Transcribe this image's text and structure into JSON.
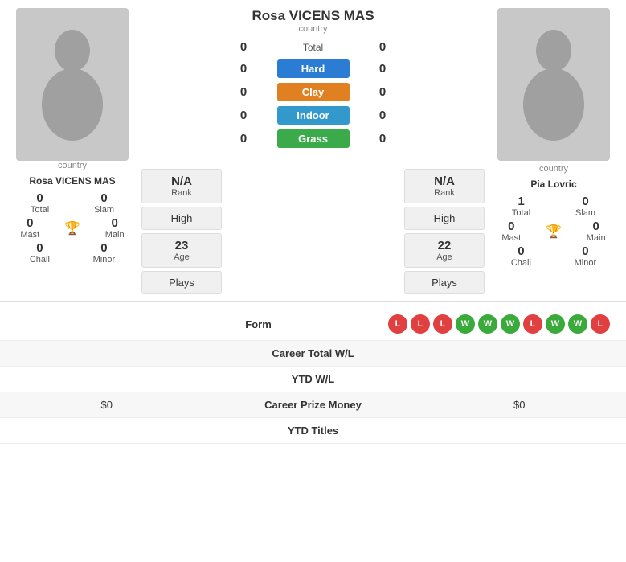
{
  "player1": {
    "name": "Rosa VICENS MAS",
    "country": "country",
    "stats": {
      "total_wins": "0",
      "total_label": "Total",
      "slam_wins": "0",
      "slam_label": "Slam",
      "mast_wins": "0",
      "mast_label": "Mast",
      "main_wins": "0",
      "main_label": "Main",
      "chall_wins": "0",
      "chall_label": "Chall",
      "minor_wins": "0",
      "minor_label": "Minor"
    },
    "rank": "N/A",
    "rank_label": "Rank",
    "level": "High",
    "age": "23",
    "age_label": "Age",
    "plays": "Plays",
    "career_prize": "$0",
    "ytd_titles": ""
  },
  "player2": {
    "name": "Pia Lovric",
    "country": "country",
    "stats": {
      "total_wins": "1",
      "total_label": "Total",
      "slam_wins": "0",
      "slam_label": "Slam",
      "mast_wins": "0",
      "mast_label": "Mast",
      "main_wins": "0",
      "main_label": "Main",
      "chall_wins": "0",
      "chall_label": "Chall",
      "minor_wins": "0",
      "minor_label": "Minor"
    },
    "rank": "N/A",
    "rank_label": "Rank",
    "level": "High",
    "age": "22",
    "age_label": "Age",
    "plays": "Plays",
    "career_prize": "$0",
    "ytd_titles": ""
  },
  "scores": {
    "total_left": "0",
    "total_right": "0",
    "total_label": "Total",
    "hard_left": "0",
    "hard_right": "0",
    "hard_label": "Hard",
    "clay_left": "0",
    "clay_right": "0",
    "clay_label": "Clay",
    "indoor_left": "0",
    "indoor_right": "0",
    "indoor_label": "Indoor",
    "grass_left": "0",
    "grass_right": "0",
    "grass_label": "Grass"
  },
  "form": {
    "label": "Form",
    "badges": [
      "L",
      "L",
      "L",
      "W",
      "W",
      "W",
      "L",
      "W",
      "W",
      "L"
    ]
  },
  "career_total": {
    "label": "Career Total W/L"
  },
  "ytd_wl": {
    "label": "YTD W/L"
  },
  "career_prize": {
    "label": "Career Prize Money"
  },
  "ytd_titles": {
    "label": "YTD Titles"
  }
}
